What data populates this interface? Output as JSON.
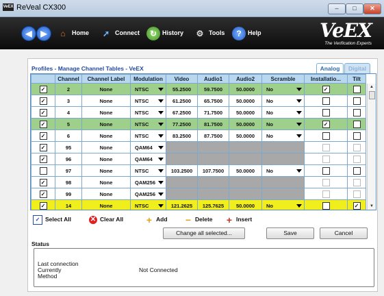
{
  "window": {
    "title": "ReVeal CX300",
    "app_badge": "VeEX"
  },
  "toolbar": {
    "items": [
      {
        "label": "Home",
        "icon": "home-icon"
      },
      {
        "label": "Connect",
        "icon": "connect-icon"
      },
      {
        "label": "History",
        "icon": "history-icon"
      },
      {
        "label": "Tools",
        "icon": "tools-icon"
      },
      {
        "label": "Help",
        "icon": "help-icon"
      }
    ],
    "logo": {
      "text": "VeEX",
      "tagline": "The Verification Experts"
    }
  },
  "page": {
    "breadcrumb": "Profiles - Manage Channel Tables - VeEX",
    "tabs": [
      {
        "label": "Analog",
        "active": true
      },
      {
        "label": "Digital",
        "active": false
      }
    ]
  },
  "table": {
    "columns": [
      "",
      "Channel",
      "Channel Label",
      "Modulation",
      "Video",
      "Audio1",
      "Audio2",
      "Scramble",
      "Installatio...",
      "Tilt"
    ],
    "rows": [
      {
        "checked": true,
        "channel": "2",
        "label": "None",
        "modulation": "NTSC",
        "video": "55.2500",
        "audio1": "59.7500",
        "audio2": "50.0000",
        "scramble": "No",
        "install": true,
        "tilt": false,
        "color": "green"
      },
      {
        "checked": true,
        "channel": "3",
        "label": "None",
        "modulation": "NTSC",
        "video": "61.2500",
        "audio1": "65.7500",
        "audio2": "50.0000",
        "scramble": "No",
        "install": false,
        "tilt": false,
        "color": ""
      },
      {
        "checked": true,
        "channel": "4",
        "label": "None",
        "modulation": "NTSC",
        "video": "67.2500",
        "audio1": "71.7500",
        "audio2": "50.0000",
        "scramble": "No",
        "install": false,
        "tilt": false,
        "color": ""
      },
      {
        "checked": true,
        "channel": "5",
        "label": "None",
        "modulation": "NTSC",
        "video": "77.2500",
        "audio1": "81.7500",
        "audio2": "50.0000",
        "scramble": "No",
        "install": true,
        "tilt": false,
        "color": "green"
      },
      {
        "checked": true,
        "channel": "6",
        "label": "None",
        "modulation": "NTSC",
        "video": "83.2500",
        "audio1": "87.7500",
        "audio2": "50.0000",
        "scramble": "No",
        "install": false,
        "tilt": false,
        "color": ""
      },
      {
        "checked": true,
        "channel": "95",
        "label": "None",
        "modulation": "QAM64",
        "video": "",
        "audio1": "",
        "audio2": "",
        "scramble": "",
        "install": false,
        "tilt": false,
        "color": "",
        "digital": true
      },
      {
        "checked": true,
        "channel": "96",
        "label": "None",
        "modulation": "QAM64",
        "video": "",
        "audio1": "",
        "audio2": "",
        "scramble": "",
        "install": false,
        "tilt": false,
        "color": "",
        "digital": true
      },
      {
        "checked": false,
        "channel": "97",
        "label": "None",
        "modulation": "NTSC",
        "video": "103.2500",
        "audio1": "107.7500",
        "audio2": "50.0000",
        "scramble": "No",
        "install": false,
        "tilt": false,
        "color": ""
      },
      {
        "checked": true,
        "channel": "98",
        "label": "None",
        "modulation": "QAM256",
        "video": "",
        "audio1": "",
        "audio2": "",
        "scramble": "",
        "install": false,
        "tilt": false,
        "color": "",
        "digital": true
      },
      {
        "checked": true,
        "channel": "99",
        "label": "None",
        "modulation": "QAM256",
        "video": "",
        "audio1": "",
        "audio2": "",
        "scramble": "",
        "install": false,
        "tilt": false,
        "color": "",
        "digital": true
      },
      {
        "checked": true,
        "channel": "14",
        "label": "None",
        "modulation": "NTSC",
        "video": "121.2625",
        "audio1": "125.7625",
        "audio2": "50.0000",
        "scramble": "No",
        "install": false,
        "tilt": true,
        "color": "yellow"
      }
    ]
  },
  "actions": {
    "select_all": "Select All",
    "clear_all": "Clear All",
    "add": "Add",
    "delete": "Delete",
    "insert": "Insert"
  },
  "buttons": {
    "change_all": "Change all selected...",
    "save": "Save",
    "cancel": "Cancel"
  },
  "status": {
    "heading": "Status",
    "last_connection_label": "Last connection",
    "currently_label": "Currently",
    "method_label": "Method",
    "currently_value": "Not Connected"
  },
  "colors": {
    "green_row": "#9ed08c",
    "yellow_row": "#f0ee1c",
    "header": "#b9d7ee",
    "accent": "#2449a3"
  }
}
